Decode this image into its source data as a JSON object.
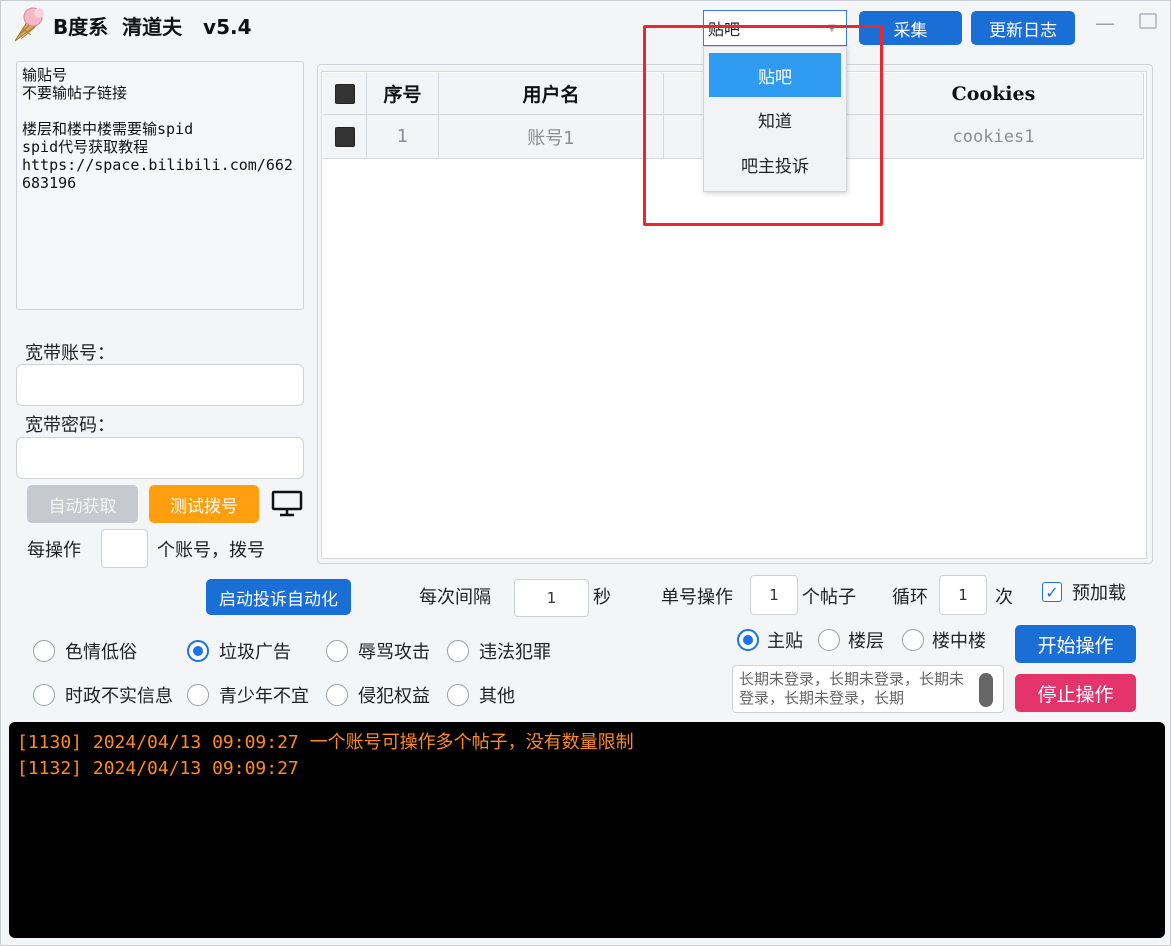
{
  "app": {
    "title": "B度系  清道夫   v5.4"
  },
  "info_text": "输贴号\n不要输帖子链接\n\n楼层和楼中楼需要输spid\nspid代号获取教程\nhttps://space.bilibili.com/662683196",
  "broadband": {
    "account_label": "宽带账号：",
    "password_label": "宽带密码：",
    "account_value": "",
    "password_value": ""
  },
  "buttons": {
    "auto_get": "自动获取",
    "test_dial": "测试拨号",
    "collect": "采集",
    "changelog": "更新日志",
    "start_complaint": "启动投诉自动化",
    "start_op": "开始操作",
    "stop_op": "停止操作"
  },
  "dial": {
    "per_op_label": "每操作",
    "per_op_value": "",
    "suffix": "个账号，拨号"
  },
  "table": {
    "headers": [
      "",
      "序号",
      "用户名",
      "",
      "Cookies"
    ],
    "rows": [
      {
        "index": "1",
        "username": "账号1",
        "col4": "",
        "cookies": "cookies1"
      }
    ]
  },
  "combo": {
    "selected": "贴吧",
    "options": [
      "贴吧",
      "知道",
      "吧主投诉"
    ]
  },
  "settings": {
    "interval_label": "每次间隔",
    "interval_value": "1",
    "interval_unit": "秒",
    "single_label": "单号操作",
    "single_value": "1",
    "single_unit": "个帖子",
    "loop_label": "循环",
    "loop_value": "1",
    "loop_unit": "次",
    "preload_label": "预加载",
    "preload_checked": true
  },
  "categories": [
    {
      "label": "色情低俗",
      "selected": false
    },
    {
      "label": "垃圾广告",
      "selected": true
    },
    {
      "label": "辱骂攻击",
      "selected": false
    },
    {
      "label": "违法犯罪",
      "selected": false
    },
    {
      "label": "时政不实信息",
      "selected": false
    },
    {
      "label": "青少年不宜",
      "selected": false
    },
    {
      "label": "侵犯权益",
      "selected": false
    },
    {
      "label": "其他",
      "selected": false
    }
  ],
  "post_types": [
    {
      "label": "主贴",
      "selected": true
    },
    {
      "label": "楼层",
      "selected": false
    },
    {
      "label": "楼中楼",
      "selected": false
    }
  ],
  "preview_text": "长期未登录，长期未登录，长期未登录，长期未登录，长期",
  "log": [
    "[1130] 2024/04/13 09:09:27 一个账号可操作多个帖子，没有数量限制",
    "[1132] 2024/04/13 09:09:27"
  ],
  "colors": {
    "accent_blue": "#1a6fd6",
    "orange": "#ff9f0f",
    "pink": "#e5336e",
    "log_text": "#ff8a1a",
    "highlight": "#e8282c"
  }
}
